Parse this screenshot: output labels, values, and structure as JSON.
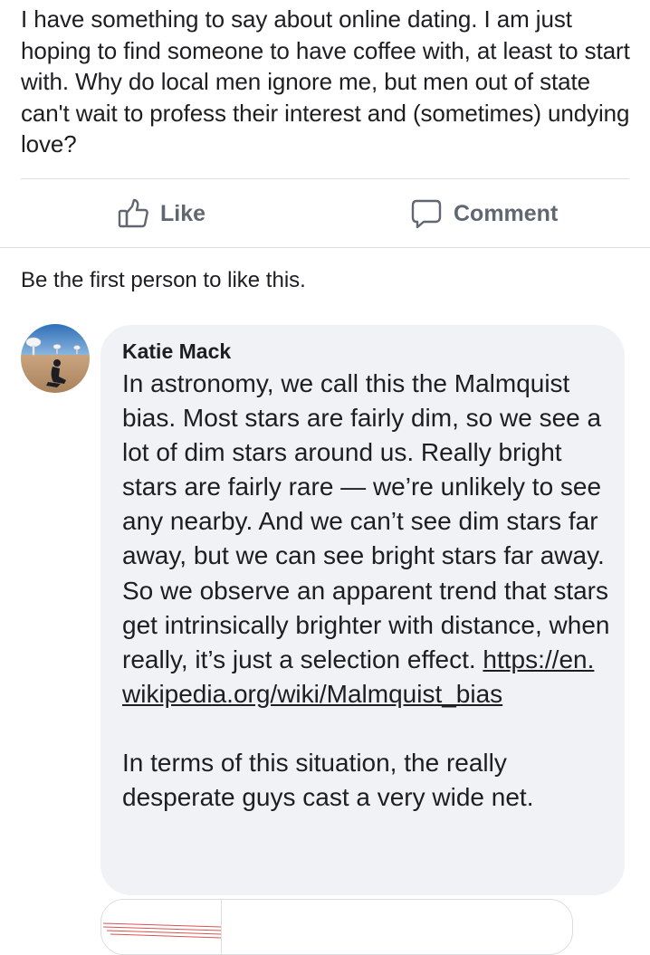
{
  "post": {
    "text": "I have something to say about online dating. I am just hoping to find someone to have coffee with, at least to start with. Why do local men ignore me, but men out of state can't wait to profess their interest and (sometimes) undying love?"
  },
  "actions": {
    "like_label": "Like",
    "comment_label": "Comment"
  },
  "reactions": {
    "summary": "Be the first person to like this."
  },
  "comment": {
    "author": "Katie Mack",
    "text_part1": "In astronomy, we call this the Malmquist bias. Most stars are fairly dim, so we see a lot of dim stars around us. Really bright stars are fairly rare — we’re unlikely to see any nearby. And we can’t see dim stars far away, but we can see bright stars far away. So we observe an apparent trend that stars get intrinsically brighter with distance, when really, it’s just a selection effect.",
    "link_text": "https://en.wikipedia.org/wiki/Malmquist_bias",
    "text_part2": "In terms of this situation, the really desperate guys cast a very wide net."
  },
  "colors": {
    "icon_gray": "#606770",
    "bubble_bg": "#f0f2f5",
    "divider": "#dadde1"
  },
  "icons": {
    "like": "thumbs-up-icon",
    "comment": "speech-bubble-icon"
  }
}
